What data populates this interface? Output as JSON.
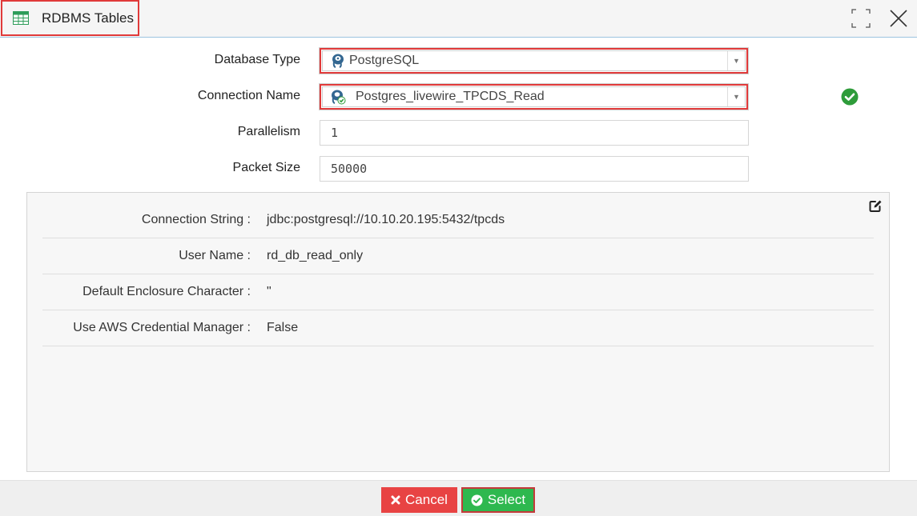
{
  "window": {
    "title": "RDBMS Tables",
    "icons": {
      "title": "table-icon",
      "maximize": "maximize-icon",
      "close": "close-icon"
    }
  },
  "form": {
    "database_type": {
      "label": "Database Type",
      "value": "PostgreSQL",
      "icon": "postgresql-icon"
    },
    "connection_name": {
      "label": "Connection Name",
      "value": "Postgres_livewire_TPCDS_Read",
      "icon": "postgresql-connection-icon",
      "status_icon": "check-circle-icon"
    },
    "parallelism": {
      "label": "Parallelism",
      "value": "1"
    },
    "packet_size": {
      "label": "Packet Size",
      "value": "50000"
    }
  },
  "details": {
    "rows": [
      {
        "key": "Connection String :",
        "value": "jdbc:postgresql://10.10.20.195:5432/tpcds"
      },
      {
        "key": "User Name :",
        "value": "rd_db_read_only"
      },
      {
        "key": "Default Enclosure Character :",
        "value": "\""
      },
      {
        "key": "Use AWS Credential Manager :",
        "value": "False"
      }
    ],
    "edit_icon": "edit-icon"
  },
  "footer": {
    "cancel_label": "Cancel",
    "select_label": "Select"
  },
  "colors": {
    "highlight_border": "#e03a3a",
    "cancel": "#e84343",
    "select": "#2eb84f",
    "success": "#2e9c3a",
    "title_icon": "#2e9c5a"
  }
}
